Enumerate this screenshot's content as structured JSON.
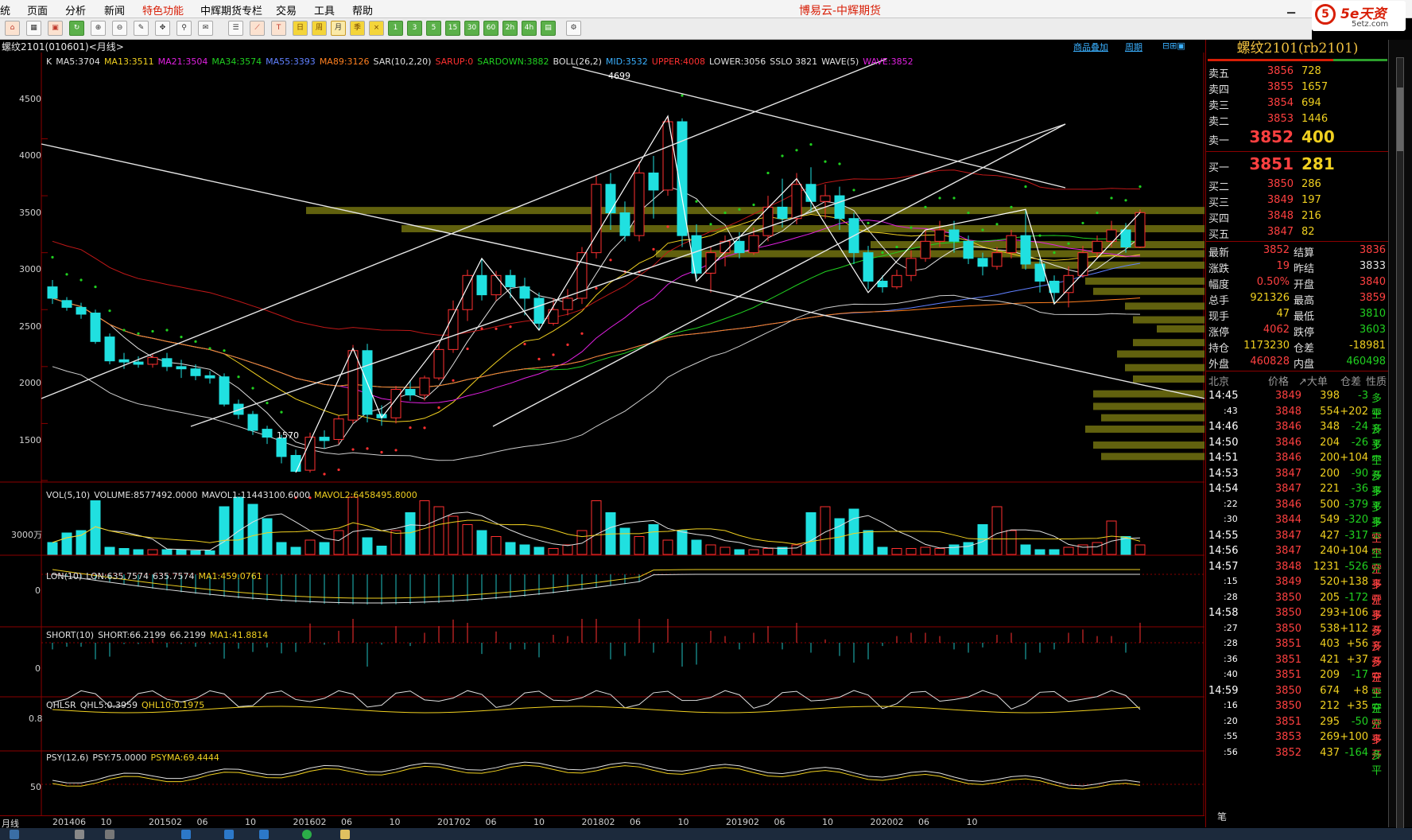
{
  "menu": {
    "items": [
      "统",
      "页面",
      "分析",
      "新闻",
      "特色功能",
      "中辉期货专栏",
      "交易",
      "工具",
      "帮助"
    ],
    "highlight_index": 4
  },
  "app_title": "博易云-中辉期货",
  "logo": {
    "mark": "5",
    "text": "5e天资",
    "sub": "5etz.com"
  },
  "toolbar": {
    "buttons": [
      "home-icon",
      "grid-icon",
      "tick-icon",
      "refresh-icon",
      "zoom-in-icon",
      "zoom-out-icon",
      "draw-icon",
      "drag-icon",
      "pin-icon",
      "news-icon",
      "table-icon",
      "trend-icon",
      "tick-chart-icon",
      "day-icon",
      "week-icon",
      "month-icon",
      "quarter-icon",
      "period-icon",
      "1m-icon",
      "3m-icon",
      "5m-icon",
      "15m-icon",
      "30m-icon",
      "60m-icon",
      "2h-icon",
      "4h-icon",
      "1h-icon",
      "settings-icon"
    ],
    "labels": {
      "day": "日",
      "week": "周",
      "month": "月",
      "quarter": "季",
      "1": "1",
      "3": "3",
      "5": "5",
      "15": "15",
      "30": "30",
      "60": "60",
      "2h": "2h",
      "4h": "4h"
    }
  },
  "subbar": {
    "title": "螺纹2101(010601)<月线>",
    "link_add": "商品叠加",
    "link_period": "周期"
  },
  "main_indicators": [
    {
      "text": "K",
      "color": "#e0e0e0"
    },
    {
      "text": "MA5:3704",
      "color": "#e0e0e0"
    },
    {
      "text": "MA13:3511",
      "color": "#f0d020"
    },
    {
      "text": "MA21:3504",
      "color": "#e020e0"
    },
    {
      "text": "MA34:3574",
      "color": "#20d020"
    },
    {
      "text": "MA55:3393",
      "color": "#6080ff"
    },
    {
      "text": "MA89:3126",
      "color": "#ff8020"
    },
    {
      "text": "SAR(10,2,20)",
      "color": "#e0e0e0"
    },
    {
      "text": "SARUP:0",
      "color": "#ff3030"
    },
    {
      "text": "SARDOWN:3882",
      "color": "#20d020"
    },
    {
      "text": "BOLL(26,2)",
      "color": "#e0e0e0"
    },
    {
      "text": "MID:3532",
      "color": "#3ab0ff"
    },
    {
      "text": "UPPER:4008",
      "color": "#ff3030"
    },
    {
      "text": "LOWER:3056",
      "color": "#e0e0e0"
    },
    {
      "text": "SSLO 3821",
      "color": "#e0e0e0"
    },
    {
      "text": "WAVE(5)",
      "color": "#e0e0e0"
    },
    {
      "text": "WAVE:3852",
      "color": "#e020e0"
    }
  ],
  "price_axis": [
    "4500",
    "4000",
    "3500",
    "3000",
    "2500",
    "2000",
    "1500"
  ],
  "price_annotations": {
    "high": "4699",
    "low": "1570"
  },
  "vol_indicators": [
    {
      "text": "VOL(5,10)",
      "color": "#e0e0e0"
    },
    {
      "text": "VOLUME:8577492.0000",
      "color": "#e0e0e0"
    },
    {
      "text": "MAVOL1:11443100.6000",
      "color": "#e0e0e0"
    },
    {
      "text": "MAVOL2:6458495.8000",
      "color": "#f0d020"
    }
  ],
  "vol_axis": "3000万",
  "lon_indicators": [
    {
      "text": "LON(10)",
      "color": "#e0e0e0"
    },
    {
      "text": "LON:635.7574",
      "color": "#e0e0e0"
    },
    {
      "text": "635.7574",
      "color": "#e0e0e0"
    },
    {
      "text": "MA1:459.0761",
      "color": "#f0d020"
    }
  ],
  "lon_axis": "0",
  "short_indicators": [
    {
      "text": "SHORT(10)",
      "color": "#e0e0e0"
    },
    {
      "text": "SHORT:66.2199",
      "color": "#e0e0e0"
    },
    {
      "text": "66.2199",
      "color": "#e0e0e0"
    },
    {
      "text": "MA1:41.8814",
      "color": "#f0d020"
    }
  ],
  "short_axis": "0",
  "qhl_indicators": [
    {
      "text": "QHLSR",
      "color": "#e0e0e0"
    },
    {
      "text": "QHL5:0.3959",
      "color": "#e0e0e0"
    },
    {
      "text": "QHL10:0.1975",
      "color": "#f0d020"
    }
  ],
  "qhl_axis": "0.8",
  "psy_indicators": [
    {
      "text": "PSY(12,6)",
      "color": "#e0e0e0"
    },
    {
      "text": "PSY:75.0000",
      "color": "#e0e0e0"
    },
    {
      "text": "PSYMA:69.4444",
      "color": "#f0d020"
    }
  ],
  "psy_axis": "50",
  "dates": {
    "label": "月线",
    "ticks": [
      "201406",
      "10",
      "201502",
      "06",
      "10",
      "201602",
      "06",
      "10",
      "201702",
      "06",
      "10",
      "201802",
      "06",
      "10",
      "201902",
      "06",
      "10",
      "202002",
      "06",
      "10"
    ]
  },
  "right_panel": {
    "title": "螺纹2101(rb2101)",
    "asks": [
      {
        "label": "卖五",
        "price": "3856",
        "vol": "728"
      },
      {
        "label": "卖四",
        "price": "3855",
        "vol": "1657"
      },
      {
        "label": "卖三",
        "price": "3854",
        "vol": "694"
      },
      {
        "label": "卖二",
        "price": "3853",
        "vol": "1446"
      },
      {
        "label": "卖一",
        "price": "3852",
        "vol": "400"
      }
    ],
    "bids": [
      {
        "label": "买一",
        "price": "3851",
        "vol": "281"
      },
      {
        "label": "买二",
        "price": "3850",
        "vol": "286"
      },
      {
        "label": "买三",
        "price": "3849",
        "vol": "197"
      },
      {
        "label": "买四",
        "price": "3848",
        "vol": "216"
      },
      {
        "label": "买五",
        "price": "3847",
        "vol": "82"
      }
    ],
    "stats": [
      {
        "l1": "最新",
        "v1": "3852",
        "c1": "#ff4040",
        "l2": "结算",
        "v2": "3836",
        "c2": "#ff4040"
      },
      {
        "l1": "涨跌",
        "v1": "19",
        "c1": "#ff4040",
        "l2": "昨结",
        "v2": "3833",
        "c2": "#e0e0e0"
      },
      {
        "l1": "幅度",
        "v1": "0.50%",
        "c1": "#ff4040",
        "l2": "开盘",
        "v2": "3840",
        "c2": "#ff4040"
      },
      {
        "l1": "总手",
        "v1": "921326",
        "c1": "#f0d020",
        "l2": "最高",
        "v2": "3859",
        "c2": "#ff4040"
      },
      {
        "l1": "现手",
        "v1": "47",
        "c1": "#f0d020",
        "l2": "最低",
        "v2": "3810",
        "c2": "#20d020"
      },
      {
        "l1": "涨停",
        "v1": "4062",
        "c1": "#ff4040",
        "l2": "跌停",
        "v2": "3603",
        "c2": "#20d020"
      },
      {
        "l1": "持仓",
        "v1": "1173230",
        "c1": "#f0d020",
        "l2": "仓差",
        "v2": "-18981",
        "c2": "#f0d020"
      },
      {
        "l1": "外盘",
        "v1": "460828",
        "c1": "#ff4040",
        "l2": "内盘",
        "v2": "460498",
        "c2": "#20d020"
      }
    ],
    "ticks_header": {
      "place": "北京",
      "price": "价格",
      "bigorder": "↗大单",
      "oi": "仓差",
      "nature": "性质"
    },
    "ticks": [
      {
        "time": "14:45",
        "price": "3849",
        "vol": "398",
        "oi": "-3",
        "nat": "多平",
        "pc": "#ff4040",
        "oc": "#20d020",
        "nc": "#20d020"
      },
      {
        "time": ":43",
        "price": "3848",
        "vol": "554",
        "oi": "+202",
        "nat": "空开",
        "pc": "#ff4040",
        "oc": "#f0d020",
        "nc": "#20d020"
      },
      {
        "time": "14:46",
        "price": "3846",
        "vol": "348",
        "oi": "-24",
        "nat": "多平",
        "pc": "#ff4040",
        "oc": "#20d020",
        "nc": "#20d020"
      },
      {
        "time": "14:50",
        "price": "3846",
        "vol": "204",
        "oi": "-26",
        "nat": "多平",
        "pc": "#ff4040",
        "oc": "#20d020",
        "nc": "#20d020"
      },
      {
        "time": "14:51",
        "price": "3846",
        "vol": "200",
        "oi": "+104",
        "nat": "空开",
        "pc": "#ff4040",
        "oc": "#f0d020",
        "nc": "#20d020"
      },
      {
        "time": "14:53",
        "price": "3847",
        "vol": "200",
        "oi": "-90",
        "nat": "多平",
        "pc": "#ff4040",
        "oc": "#20d020",
        "nc": "#20d020"
      },
      {
        "time": "14:54",
        "price": "3847",
        "vol": "221",
        "oi": "-36",
        "nat": "多平",
        "pc": "#ff4040",
        "oc": "#20d020",
        "nc": "#20d020"
      },
      {
        "time": ":22",
        "price": "3846",
        "vol": "500",
        "oi": "-379",
        "nat": "多平",
        "pc": "#ff4040",
        "oc": "#20d020",
        "nc": "#20d020"
      },
      {
        "time": ":30",
        "price": "3844",
        "vol": "549",
        "oi": "-320",
        "nat": "多平",
        "pc": "#ff4040",
        "oc": "#20d020",
        "nc": "#20d020"
      },
      {
        "time": "14:55",
        "price": "3847",
        "vol": "427",
        "oi": "-317",
        "nat": "空平",
        "pc": "#ff4040",
        "oc": "#20d020",
        "nc": "#ff4040"
      },
      {
        "time": "14:56",
        "price": "3847",
        "vol": "240",
        "oi": "+104",
        "nat": "空开",
        "pc": "#ff4040",
        "oc": "#f0d020",
        "nc": "#20d020"
      },
      {
        "time": "14:57",
        "price": "3848",
        "vol": "1231",
        "oi": "-526",
        "nat": "空平",
        "pc": "#ff4040",
        "oc": "#20d020",
        "nc": "#ff4040"
      },
      {
        "time": ":15",
        "price": "3849",
        "vol": "520",
        "oi": "+138",
        "nat": "多开",
        "pc": "#ff4040",
        "oc": "#f0d020",
        "nc": "#ff4040"
      },
      {
        "time": ":28",
        "price": "3850",
        "vol": "205",
        "oi": "-172",
        "nat": "空平",
        "pc": "#ff4040",
        "oc": "#20d020",
        "nc": "#ff4040"
      },
      {
        "time": "14:58",
        "price": "3850",
        "vol": "293",
        "oi": "+106",
        "nat": "多开",
        "pc": "#ff4040",
        "oc": "#f0d020",
        "nc": "#ff4040"
      },
      {
        "time": ":27",
        "price": "3850",
        "vol": "538",
        "oi": "+112",
        "nat": "多开",
        "pc": "#ff4040",
        "oc": "#f0d020",
        "nc": "#ff4040"
      },
      {
        "time": ":28",
        "price": "3851",
        "vol": "403",
        "oi": "+56",
        "nat": "多开",
        "pc": "#ff4040",
        "oc": "#f0d020",
        "nc": "#ff4040"
      },
      {
        "time": ":36",
        "price": "3851",
        "vol": "421",
        "oi": "+37",
        "nat": "多开",
        "pc": "#ff4040",
        "oc": "#f0d020",
        "nc": "#ff4040"
      },
      {
        "time": ":40",
        "price": "3851",
        "vol": "209",
        "oi": "-17",
        "nat": "空平",
        "pc": "#ff4040",
        "oc": "#20d020",
        "nc": "#ff4040"
      },
      {
        "time": "14:59",
        "price": "3850",
        "vol": "674",
        "oi": "+8",
        "nat": "空开",
        "pc": "#ff4040",
        "oc": "#f0d020",
        "nc": "#20d020"
      },
      {
        "time": ":16",
        "price": "3850",
        "vol": "212",
        "oi": "+35",
        "nat": "空开",
        "pc": "#ff4040",
        "oc": "#f0d020",
        "nc": "#20d020"
      },
      {
        "time": ":20",
        "price": "3851",
        "vol": "295",
        "oi": "-50",
        "nat": "空平",
        "pc": "#ff4040",
        "oc": "#20d020",
        "nc": "#ff4040"
      },
      {
        "time": ":55",
        "price": "3853",
        "vol": "269",
        "oi": "+100",
        "nat": "多开",
        "pc": "#ff4040",
        "oc": "#f0d020",
        "nc": "#ff4040"
      },
      {
        "time": ":56",
        "price": "3852",
        "vol": "437",
        "oi": "-164",
        "nat": "多平",
        "pc": "#ff4040",
        "oc": "#20d020",
        "nc": "#20d020"
      }
    ],
    "footer_tab": "笔"
  },
  "chart_data": {
    "type": "candlestick",
    "period": "月线",
    "ylim": [
      1400,
      4800
    ],
    "candles": [
      [
        3200,
        3100,
        3260,
        3050
      ],
      [
        3080,
        3020,
        3110,
        2990
      ],
      [
        3020,
        2960,
        3060,
        2920
      ],
      [
        2970,
        2720,
        3000,
        2700
      ],
      [
        2760,
        2550,
        2790,
        2520
      ],
      [
        2560,
        2540,
        2620,
        2480
      ],
      [
        2540,
        2520,
        2590,
        2490
      ],
      [
        2520,
        2580,
        2610,
        2490
      ],
      [
        2570,
        2500,
        2620,
        2460
      ],
      [
        2500,
        2480,
        2560,
        2400
      ],
      [
        2480,
        2420,
        2520,
        2380
      ],
      [
        2420,
        2400,
        2460,
        2350
      ],
      [
        2410,
        2170,
        2440,
        2150
      ],
      [
        2170,
        2080,
        2210,
        2040
      ],
      [
        2080,
        1940,
        2110,
        1900
      ],
      [
        1950,
        1880,
        1980,
        1820
      ],
      [
        1870,
        1710,
        1900,
        1650
      ],
      [
        1720,
        1580,
        1770,
        1570
      ],
      [
        1590,
        1880,
        1920,
        1570
      ],
      [
        1880,
        1850,
        1940,
        1780
      ],
      [
        1860,
        2040,
        2070,
        1820
      ],
      [
        2030,
        2640,
        2690,
        2000
      ],
      [
        2640,
        2080,
        2700,
        2010
      ],
      [
        2080,
        2050,
        2160,
        1980
      ],
      [
        2050,
        2300,
        2330,
        2000
      ],
      [
        2300,
        2250,
        2380,
        2200
      ],
      [
        2250,
        2400,
        2420,
        2200
      ],
      [
        2400,
        2650,
        2700,
        2380
      ],
      [
        2650,
        3000,
        3080,
        2620
      ],
      [
        3000,
        3300,
        3350,
        2900
      ],
      [
        3300,
        3130,
        3450,
        3080
      ],
      [
        3130,
        3300,
        3340,
        3080
      ],
      [
        3300,
        3200,
        3350,
        3100
      ],
      [
        3200,
        3100,
        3280,
        2950
      ],
      [
        3100,
        2880,
        3150,
        2820
      ],
      [
        2880,
        3000,
        3100,
        2860
      ],
      [
        3000,
        3100,
        3180,
        2950
      ],
      [
        3100,
        3500,
        3550,
        3050
      ],
      [
        3500,
        4100,
        4180,
        3450
      ],
      [
        4100,
        3850,
        4200,
        3700
      ],
      [
        3850,
        3650,
        3950,
        3600
      ],
      [
        3650,
        4200,
        4300,
        3600
      ],
      [
        4200,
        4050,
        4350,
        3800
      ],
      [
        4050,
        4650,
        4699,
        4000
      ],
      [
        4650,
        3650,
        4680,
        3550
      ],
      [
        3650,
        3320,
        3750,
        3250
      ],
      [
        3320,
        3500,
        3550,
        3150
      ],
      [
        3500,
        3600,
        3650,
        3380
      ],
      [
        3600,
        3500,
        3680,
        3450
      ],
      [
        3500,
        3650,
        3720,
        3480
      ],
      [
        3650,
        3900,
        4000,
        3600
      ],
      [
        3900,
        3800,
        4150,
        3720
      ],
      [
        3800,
        4100,
        4200,
        3750
      ],
      [
        4100,
        3950,
        4250,
        3850
      ],
      [
        3950,
        4000,
        4100,
        3800
      ],
      [
        4000,
        3800,
        4080,
        3700
      ],
      [
        3800,
        3500,
        3850,
        3400
      ],
      [
        3500,
        3250,
        3560,
        3180
      ],
      [
        3250,
        3200,
        3300,
        3150
      ],
      [
        3200,
        3300,
        3350,
        3180
      ],
      [
        3300,
        3450,
        3520,
        3250
      ],
      [
        3450,
        3600,
        3700,
        3420
      ],
      [
        3600,
        3700,
        3780,
        3550
      ],
      [
        3700,
        3600,
        3780,
        3500
      ],
      [
        3600,
        3450,
        3650,
        3400
      ],
      [
        3450,
        3380,
        3500,
        3300
      ],
      [
        3380,
        3500,
        3550,
        3350
      ],
      [
        3500,
        3650,
        3700,
        3450
      ],
      [
        3650,
        3400,
        3880,
        3350
      ],
      [
        3400,
        3250,
        3450,
        3150
      ],
      [
        3250,
        3150,
        3300,
        3050
      ],
      [
        3150,
        3300,
        3380,
        3020
      ],
      [
        3300,
        3500,
        3560,
        3280
      ],
      [
        3500,
        3600,
        3650,
        3450
      ],
      [
        3600,
        3700,
        3780,
        3550
      ],
      [
        3700,
        3550,
        3760,
        3500
      ],
      [
        3550,
        3852,
        3880,
        3540
      ]
    ],
    "volumes": [
      10,
      18,
      20,
      45,
      6,
      5,
      4,
      4,
      4,
      4,
      3,
      3,
      40,
      48,
      42,
      30,
      10,
      6,
      12,
      10,
      20,
      48,
      14,
      7,
      20,
      35,
      45,
      40,
      32,
      25,
      20,
      15,
      10,
      8,
      6,
      5,
      8,
      20,
      45,
      35,
      22,
      15,
      25,
      12,
      20,
      12,
      8,
      6,
      4,
      4,
      5,
      6,
      8,
      35,
      40,
      30,
      38,
      20,
      6,
      5,
      5,
      6,
      5,
      8,
      10,
      25,
      40,
      20,
      8,
      4,
      4,
      6,
      8,
      10,
      28,
      15,
      8
    ]
  }
}
